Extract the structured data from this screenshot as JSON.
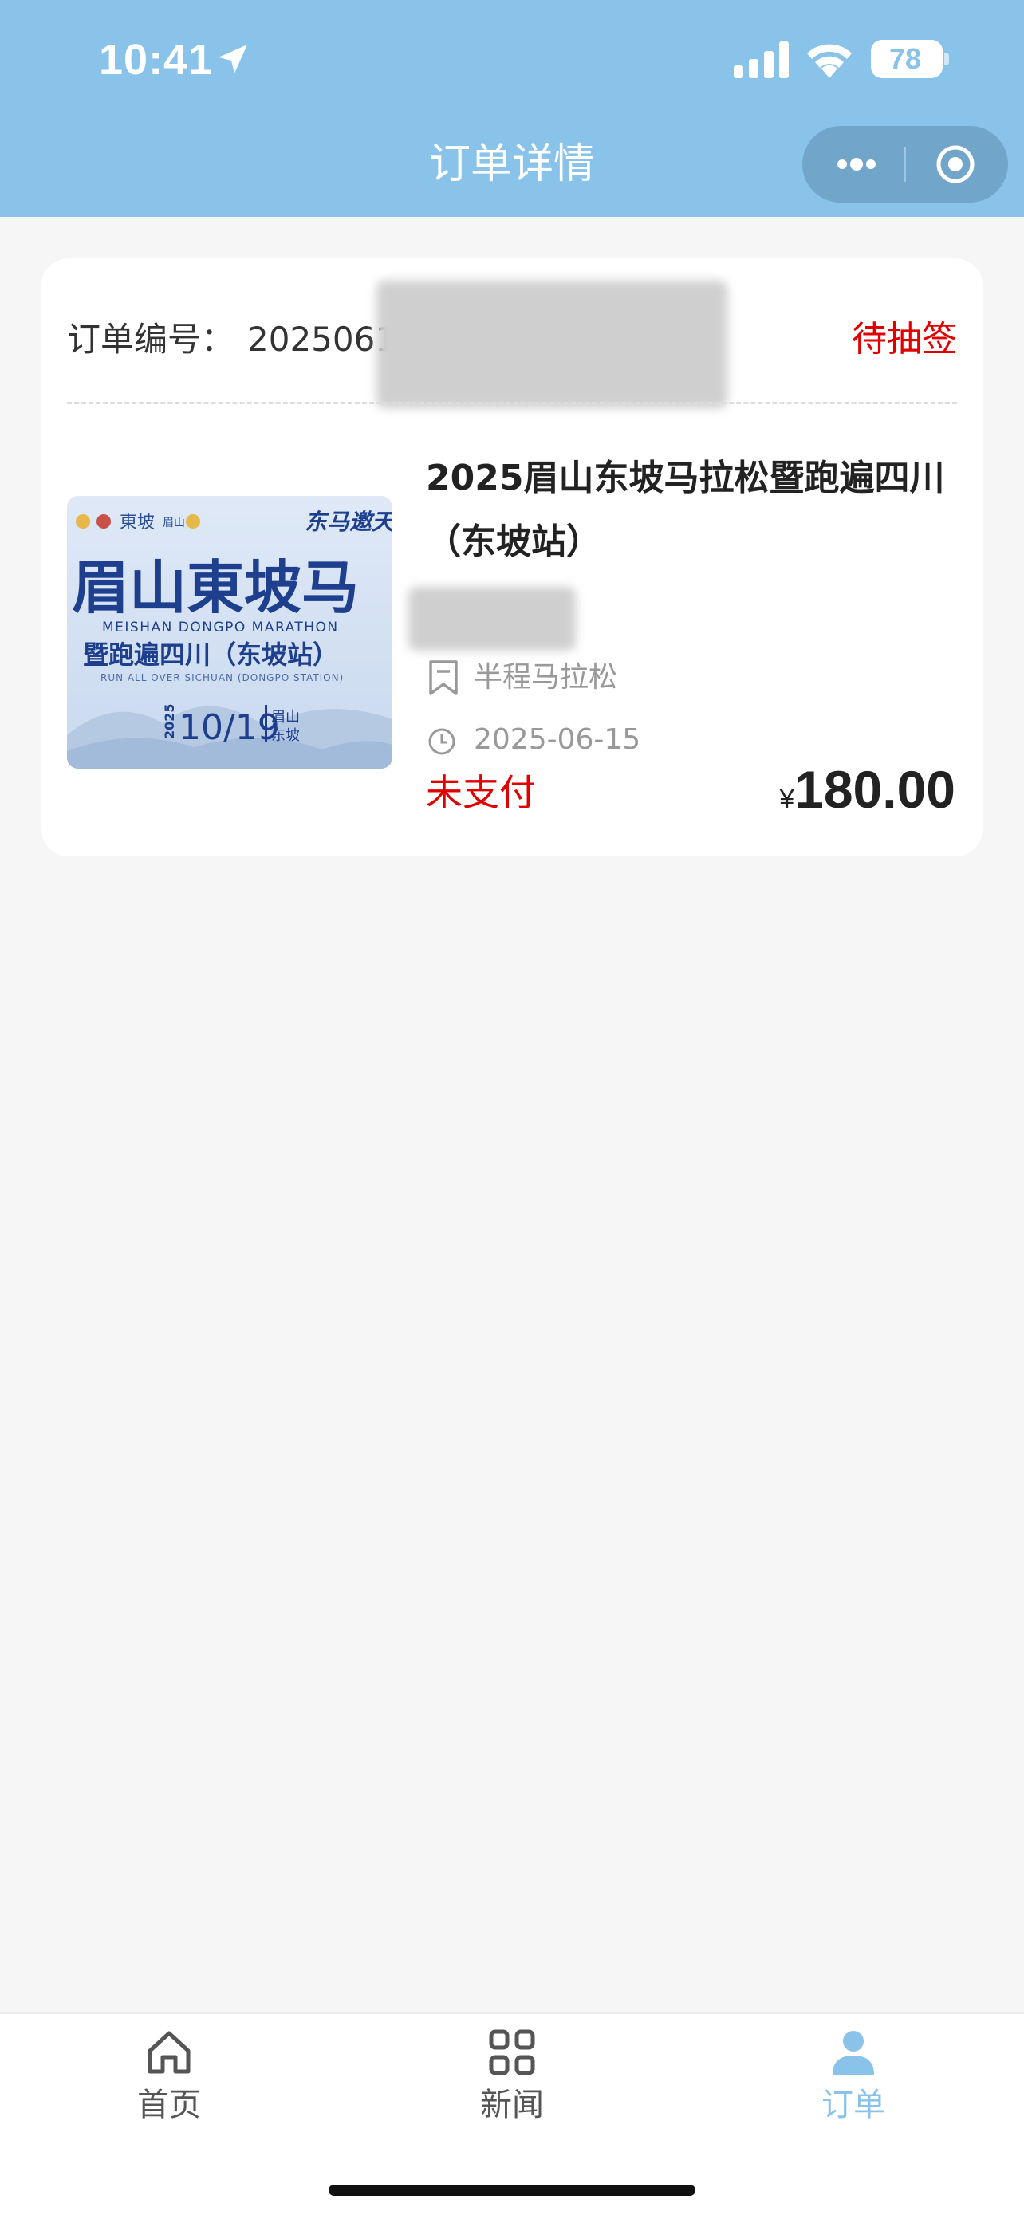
{
  "status_bar": {
    "time": "10:41",
    "battery": "78"
  },
  "nav": {
    "title": "订单详情"
  },
  "order": {
    "number_label": "订单编号：",
    "number_value": "2025061510",
    "status": "待抽签",
    "event_title": "2025眉山东坡马拉松暨跑遍四川（东坡站）",
    "category": "半程马拉松",
    "date": "2025-06-15",
    "payment_status": "未支付",
    "currency_symbol": "¥",
    "price": "180.00"
  },
  "poster": {
    "slogan": "东马邀天下",
    "title_main": "眉山東坡马",
    "title_en": "MEISHAN DONGPO MARATHON",
    "subtitle": "暨跑遍四川（东坡站）",
    "subtitle_en": "RUN ALL OVER SICHUAN (DONGPO STATION)",
    "year": "2025",
    "date": "10/19",
    "city_line1": "眉山",
    "city_line2": "东坡"
  },
  "tabbar": {
    "items": [
      {
        "label": "首页",
        "icon": "home-icon"
      },
      {
        "label": "新闻",
        "icon": "grid-icon"
      },
      {
        "label": "订单",
        "icon": "person-icon"
      }
    ],
    "active_color": "#8ac3ea"
  },
  "colors": {
    "header_bg": "#8ac3ea",
    "alert_red": "#e00000",
    "page_bg": "#f6f6f6"
  }
}
